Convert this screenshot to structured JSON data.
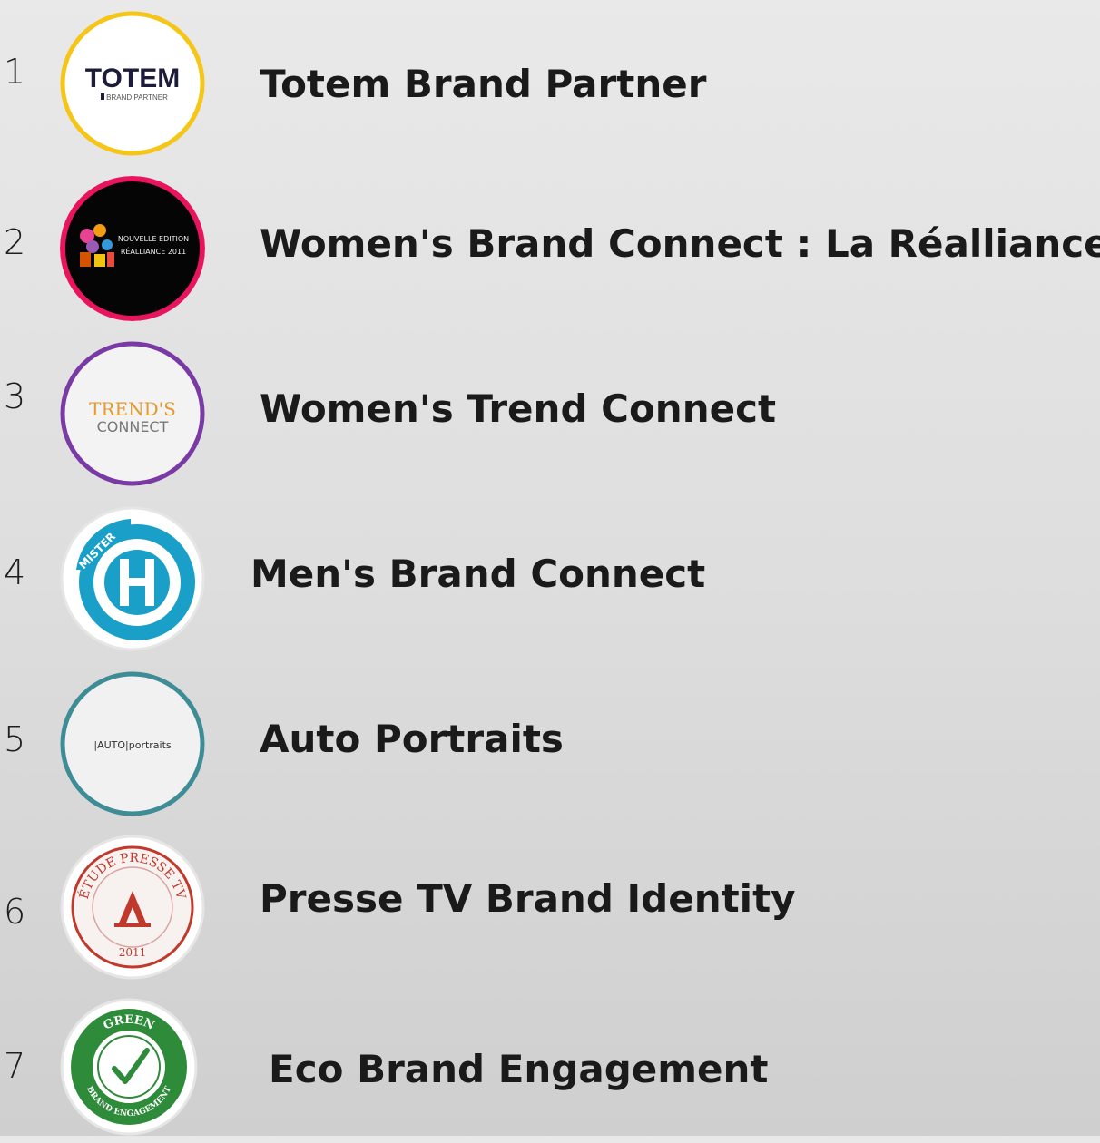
{
  "brands": [
    {
      "number": "1",
      "name": "Totem Brand Partner",
      "logo": {
        "icon": "totem-brand-partner-logo",
        "text": "TOTEM",
        "subtext": "BRAND PARTNER",
        "ring_color": "#f5c518"
      }
    },
    {
      "number": "2",
      "name": "Women's Brand Connect : La Réalliance",
      "logo": {
        "icon": "la-realliance-logo",
        "text": "NOUVELLE EDITION",
        "subtext": "RÉALLIANCE 2011",
        "ring_color": "#e8155e"
      }
    },
    {
      "number": "3",
      "name": "Women's Trend Connect",
      "logo": {
        "icon": "trends-connect-logo",
        "text": "TREND'S",
        "subtext": "CONNECT",
        "ring_color": "#7a3aa6"
      }
    },
    {
      "number": "4",
      "name": "Men's Brand Connect",
      "logo": {
        "icon": "mister-h-logo",
        "text": "MISTER",
        "subtext": "H",
        "ring_color": "#1aa0c8"
      }
    },
    {
      "number": "5",
      "name": "Auto Portraits",
      "logo": {
        "icon": "auto-portraits-logo",
        "text": "|AUTO|portraits",
        "ring_color": "#3e8c96"
      }
    },
    {
      "number": "6",
      "name": "Presse TV Brand Identity",
      "logo": {
        "icon": "etude-presse-tv-seal-icon",
        "text": "ÉTUDE PRESSE TV",
        "subtext": "2011",
        "ring_color": "#c0392b"
      }
    },
    {
      "number": "7",
      "name": "Eco Brand Engagement",
      "logo": {
        "icon": "green-brand-engagement-stamp-icon",
        "text": "GREEN",
        "subtext": "BRAND ENGAGEMENT",
        "ring_color": "#2e8b3a"
      }
    }
  ]
}
